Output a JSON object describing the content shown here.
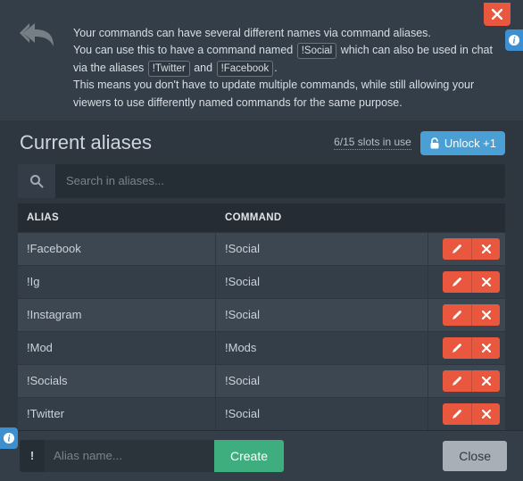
{
  "intro": {
    "line1_pre": "Your commands can have several different names via command aliases.",
    "line2_pre": "You can use this to have a command named ",
    "tag1": "!Social",
    "line2_mid": " which can also be used in chat via the aliases ",
    "tag2": "!Twitter",
    "line2_and": " and ",
    "tag3": "!Facebook",
    "line2_end": ".",
    "line3": "This means you don't have to update multiple commands, while still allowing your viewers to use differently named commands for the same purpose."
  },
  "section_title": "Current aliases",
  "slots": "6/15 slots in use",
  "unlock_label": "Unlock +1",
  "search_placeholder": "Search in aliases...",
  "headers": {
    "alias": "ALIAS",
    "command": "COMMAND"
  },
  "rows": [
    {
      "alias": "!Facebook",
      "command": "!Social"
    },
    {
      "alias": "!Ig",
      "command": "!Social"
    },
    {
      "alias": "!Instagram",
      "command": "!Social"
    },
    {
      "alias": "!Mod",
      "command": "!Mods"
    },
    {
      "alias": "!Socials",
      "command": "!Social"
    },
    {
      "alias": "!Twitter",
      "command": "!Social"
    }
  ],
  "bang": "!",
  "alias_placeholder": "Alias name...",
  "create_label": "Create",
  "close_label": "Close",
  "info_char": "i"
}
